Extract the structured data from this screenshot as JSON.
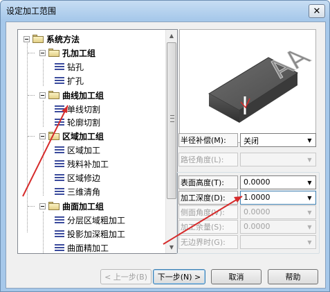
{
  "window": {
    "title": "设定加工范围"
  },
  "icons": {
    "close": "close-icon",
    "folder": "folder-icon",
    "operation": "operation-icon",
    "expander": "tree-expander-icon"
  },
  "tree": {
    "root": "系统方法",
    "groups": [
      {
        "label": "孔加工组",
        "items": [
          "钻孔",
          "扩孔"
        ]
      },
      {
        "label": "曲线加工组",
        "items": [
          "单线切割",
          "轮廓切割"
        ]
      },
      {
        "label": "区域加工组",
        "items": [
          "区域加工",
          "残料补加工",
          "区域修边",
          "三维清角"
        ]
      },
      {
        "label": "曲面加工组",
        "items": [
          "分层区域粗加工",
          "投影加深粗加工",
          "曲面精加工"
        ]
      }
    ]
  },
  "preview": {
    "text": "AA"
  },
  "form": {
    "radius_comp": {
      "label": "半径补偿(M):",
      "value": "关闭"
    },
    "path_angle": {
      "label": "路径角度(L):",
      "value": ""
    },
    "surface_height": {
      "label": "表面高度(T):",
      "value": "0.0000"
    },
    "machining_depth": {
      "label": "加工深度(D):",
      "value": "1.0000"
    },
    "side_angle": {
      "label": "侧面角度(V):",
      "value": "0.0000"
    },
    "machining_allowance": {
      "label": "加工余量(S):",
      "value": "0.0000"
    },
    "no_boundary": {
      "label": "无边界时(G):",
      "value": ""
    }
  },
  "buttons": {
    "prev": "< 上一步(B)",
    "next": "下一步(N) >",
    "cancel": "取消",
    "help": "帮助"
  },
  "colors": {
    "annotation_arrow": "#d62b2b",
    "titlebar": "#a6c8ea"
  }
}
